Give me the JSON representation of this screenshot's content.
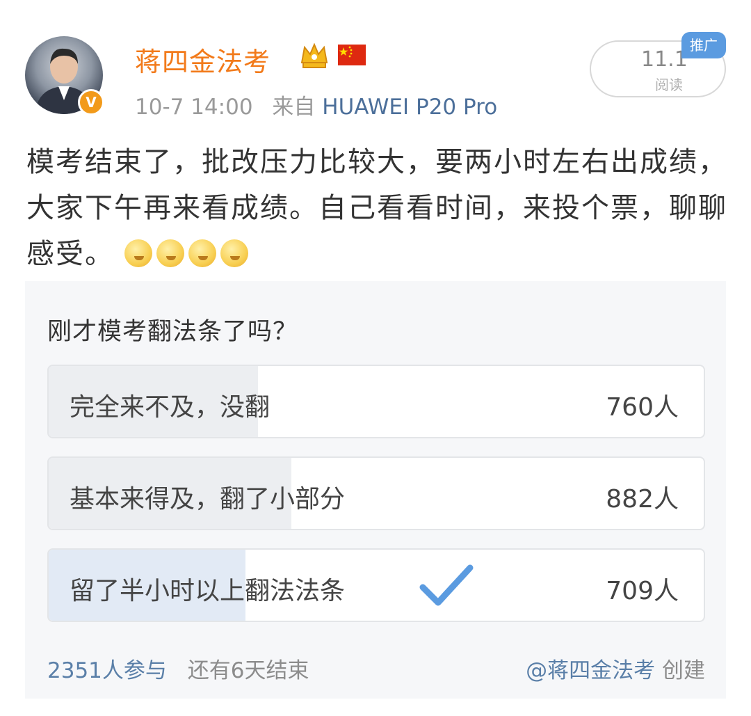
{
  "post": {
    "author": "蒋四金法考",
    "time": "10-7 14:00",
    "source_prefix": "来自",
    "source": "HUAWEI P20 Pro",
    "read_count": "11.1",
    "read_label": "阅读",
    "promo_tag": "推广",
    "text": "模考结束了，批改压力比较大，要两小时左右出成绩，大家下午再来看成绩。自己看看时间，来投个票，聊聊感受。",
    "emoji_count": 4
  },
  "poll": {
    "question": "刚才模考翻法条了吗？",
    "options": [
      {
        "label": "完全来不及，没翻",
        "count": "760人",
        "share": 0.32,
        "selected": false
      },
      {
        "label": "基本来得及，翻了小部分",
        "count": "882人",
        "share": 0.37,
        "selected": false
      },
      {
        "label": "留了半小时以上翻法法条",
        "count": "709人",
        "share": 0.3,
        "selected": true
      }
    ],
    "participants": "2351人参与",
    "remaining": "还有6天结束",
    "creator_handle": "@蒋四金法考",
    "creator_suffix": "创建"
  },
  "colors": {
    "author": "#f27a1a",
    "link": "#4c6f9a",
    "promo": "#5b9be0",
    "check": "#5b9be0",
    "poll_bg": "#f6f7f9"
  },
  "icons": {
    "verified": "v-badge-icon",
    "crown": "crown-icon",
    "flag": "china-flag-icon",
    "emoji": "emoji-icon",
    "check": "check-icon"
  }
}
